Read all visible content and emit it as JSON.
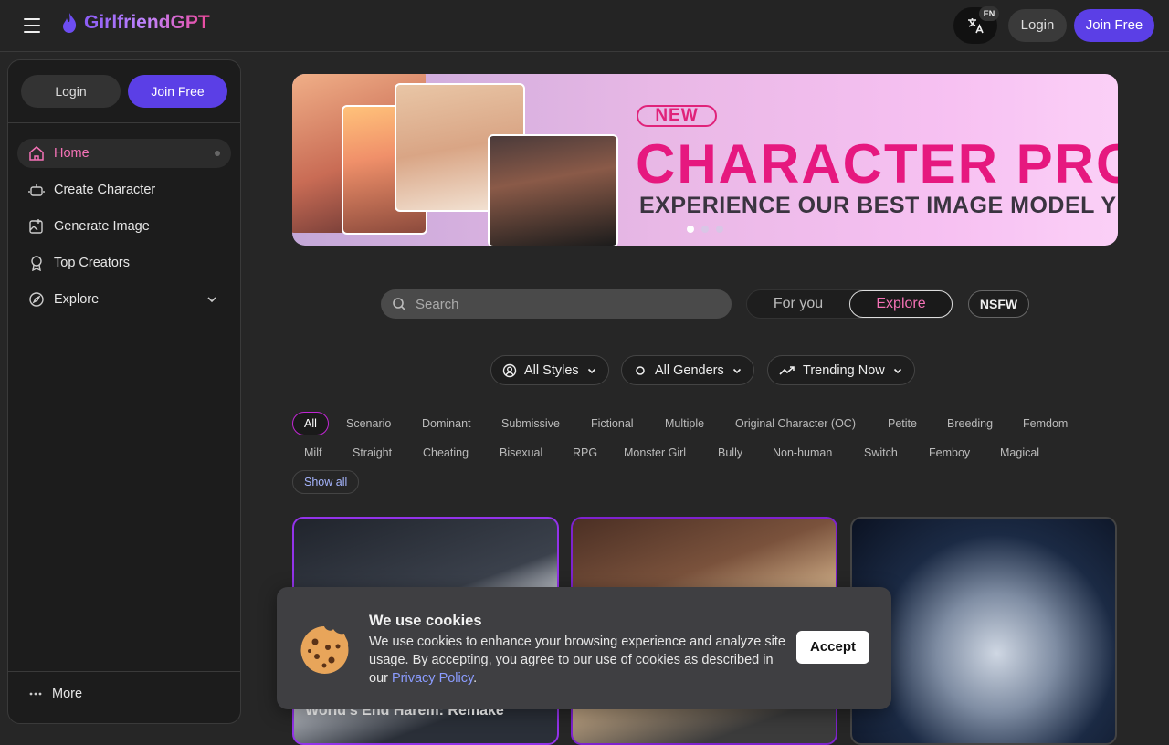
{
  "header": {
    "logo_text": "GirlfriendGPT",
    "lang_badge": "EN",
    "login_label": "Login",
    "join_label": "Join Free"
  },
  "sidebar": {
    "login_label": "Login",
    "join_label": "Join Free",
    "items": [
      {
        "label": "Home",
        "icon": "home-icon",
        "active": true
      },
      {
        "label": "Create Character",
        "icon": "robot-icon"
      },
      {
        "label": "Generate Image",
        "icon": "image-plus-icon"
      },
      {
        "label": "Top Creators",
        "icon": "award-icon"
      },
      {
        "label": "Explore",
        "icon": "compass-icon"
      }
    ],
    "more_label": "More"
  },
  "banner": {
    "badge": "NEW",
    "headline": "CHARACTER PRO",
    "subheadline": "EXPERIENCE OUR BEST IMAGE MODEL YET",
    "slide_count": 3,
    "active_slide": 1
  },
  "search": {
    "placeholder": "Search"
  },
  "feed_toggle": {
    "for_you": "For you",
    "explore": "Explore",
    "selected": "Explore"
  },
  "nsfw_label": "NSFW",
  "filters": {
    "styles": "All Styles",
    "genders": "All Genders",
    "sort": "Trending Now"
  },
  "tags": {
    "row1": [
      "All",
      "Scenario",
      "Dominant",
      "Submissive",
      "Fictional",
      "Multiple",
      "Original Character (OC)",
      "Petite",
      "Breeding",
      "Femdom"
    ],
    "row2": [
      "Milf",
      "Straight",
      "Cheating",
      "Bisexual",
      "RPG",
      "Monster Girl",
      "Bully",
      "Non-human",
      "Switch",
      "Femboy",
      "Magical"
    ],
    "show_all": "Show all",
    "selected": "All"
  },
  "cards": [
    {
      "title": "World's End Harem: Remake"
    },
    {
      "title": ""
    },
    {
      "title": ""
    }
  ],
  "cookie": {
    "title": "We use cookies",
    "text": "We use cookies to enhance your browsing experience and analyze site usage. By accepting, you agree to our use of cookies as described in our",
    "link": "Privacy Policy",
    "period": ".",
    "accept_label": "Accept"
  },
  "colors": {
    "accent": "#5b3fe6",
    "pink": "#f472b6",
    "background": "#262626"
  }
}
